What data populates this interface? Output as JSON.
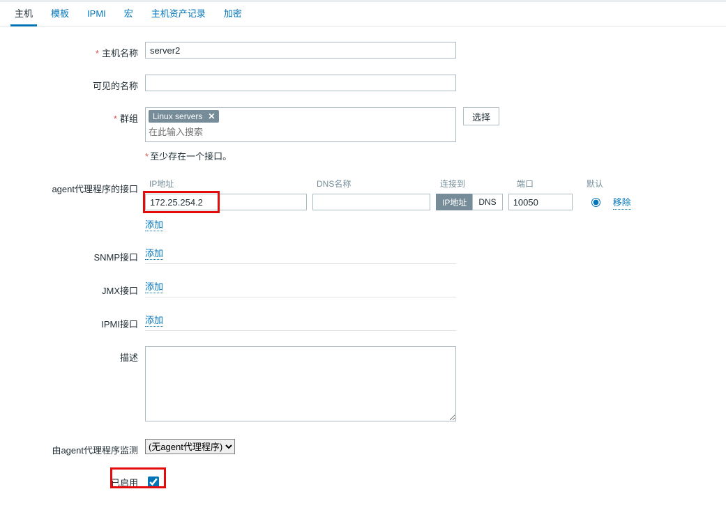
{
  "tabs": {
    "host": "主机",
    "template": "模板",
    "ipmi": "IPMI",
    "macro": "宏",
    "inventory": "主机资产记录",
    "encryption": "加密"
  },
  "labels": {
    "host_name": "主机名称",
    "visible_name": "可见的名称",
    "groups": "群组",
    "agent_if": "agent代理程序的接口",
    "snmp_if": "SNMP接口",
    "jmx_if": "JMX接口",
    "ipmi_if": "IPMI接口",
    "description": "描述",
    "monitored_by": "由agent代理程序监测",
    "enabled": "已启用"
  },
  "values": {
    "host_name": "server2",
    "visible_name": "",
    "group_tag": "Linux servers",
    "group_search_ph": "在此输入搜索",
    "select_btn": "选择",
    "hint": "至少存在一个接口。",
    "ip_header": "IP地址",
    "dns_header": "DNS名称",
    "conn_header": "连接到",
    "port_header": "端口",
    "default_header": "默认",
    "ip_value": "172.25.254.2",
    "dns_value": "",
    "seg_ip": "IP地址",
    "seg_dns": "DNS",
    "port_value": "10050",
    "remove": "移除",
    "add": "添加",
    "agent_option": "(无agent代理程序)"
  }
}
